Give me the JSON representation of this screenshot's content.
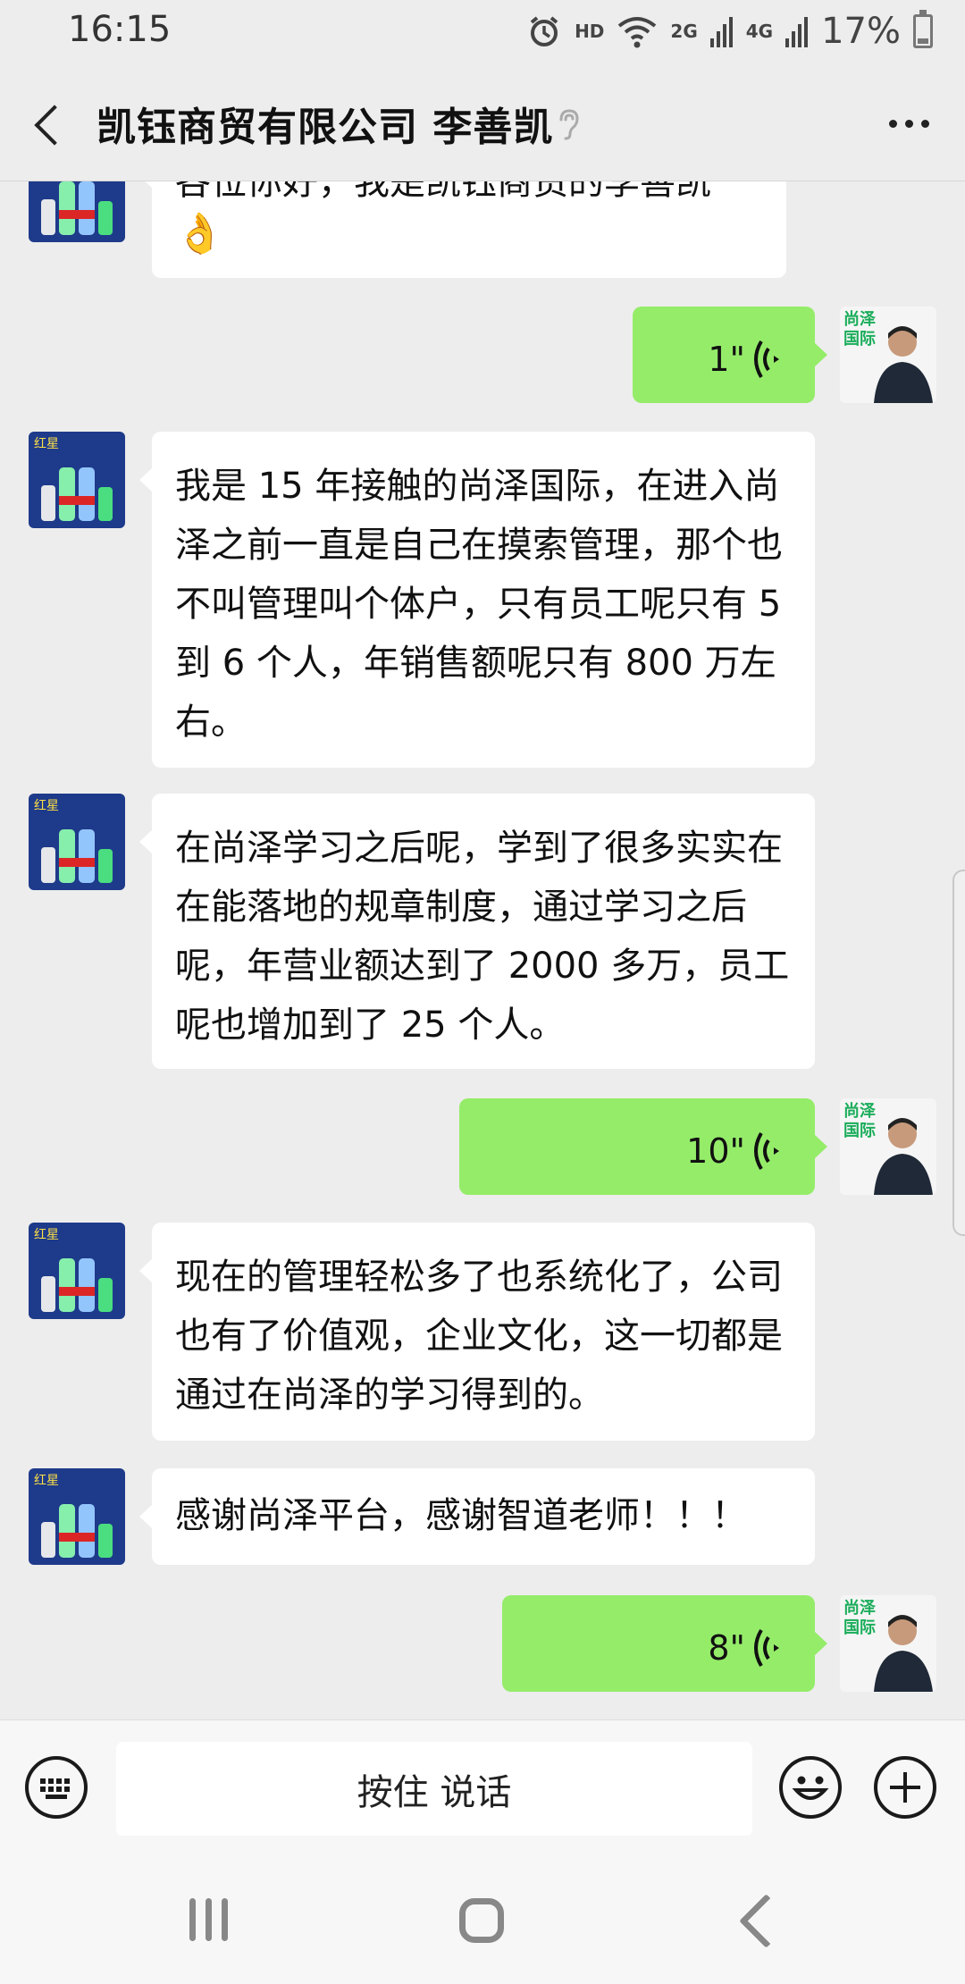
{
  "status_bar": {
    "time": "16:15",
    "hd": "HD",
    "net_2g": "2G",
    "net_4g": "4G",
    "battery": "17%"
  },
  "header": {
    "title": "凯钰商贸有限公司 李善凯",
    "icons": {
      "back": "chevron-left-icon",
      "earpiece": "ear-icon",
      "more": "more-icon"
    }
  },
  "messages": [
    {
      "side": "left",
      "type": "text",
      "text": "各位你好，我是凯钰商贸的李善凯"
    },
    {
      "side": "right",
      "type": "voice",
      "duration": "1\""
    },
    {
      "side": "left",
      "type": "text",
      "text": "我是 15 年接触的尚泽国际，在进入尚泽之前一直是自己在摸索管理，那个也不叫管理叫个体户，只有员工呢只有 5 到 6 个人，年销售额呢只有 800 万左右。"
    },
    {
      "side": "left",
      "type": "text",
      "text": "在尚泽学习之后呢，学到了很多实实在在能落地的规章制度，通过学习之后呢，年营业额达到了 2000 多万，员工呢也增加到了 25 个人。"
    },
    {
      "side": "right",
      "type": "voice",
      "duration": "10\""
    },
    {
      "side": "left",
      "type": "text",
      "text": "现在的管理轻松多了也系统化了，公司也有了价值观，企业文化，这一切都是通过在尚泽的学习得到的。"
    },
    {
      "side": "left",
      "type": "text",
      "text": "感谢尚泽平台，感谢智道老师！！！"
    },
    {
      "side": "right",
      "type": "voice",
      "duration": "8\""
    }
  ],
  "avatars": {
    "left_label": "红星",
    "right_label_line1": "尚泽",
    "right_label_line2": "国际"
  },
  "input_bar": {
    "hold_to_talk": "按住 说话"
  },
  "colors": {
    "background": "#ededed",
    "bubble_self": "#95ec69",
    "bubble_other": "#ffffff",
    "brand_green": "#1aad5a"
  }
}
